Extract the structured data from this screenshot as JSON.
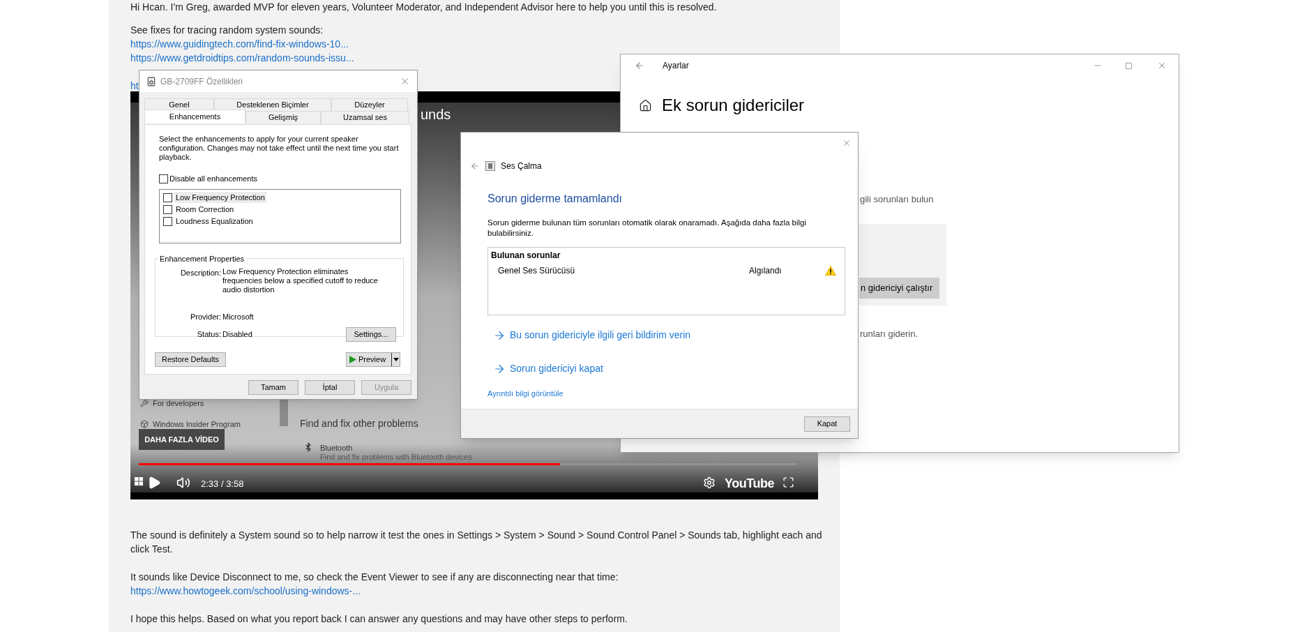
{
  "post": {
    "top_blocks": [
      [
        {
          "kind": "text",
          "text": "Hi Hcan. I'm Greg, awarded MVP for eleven years, Volunteer Moderator, and Independent Advisor here to help you until this is resolved."
        }
      ],
      [
        {
          "kind": "text",
          "text": "See fixes for tracing random system sounds:"
        },
        {
          "kind": "link",
          "text": "https://www.guidingtech.com/find-fix-windows-10..."
        },
        {
          "kind": "link",
          "text": "https://www.getdroidtips.com/random-sounds-issu..."
        }
      ],
      [
        {
          "kind": "link",
          "text": "ht"
        }
      ]
    ],
    "bottom_blocks": [
      [
        {
          "kind": "text",
          "text": "The sound is definitely a System sound so to help narrow it test the ones in Settings > System > Sound > Sound Control Panel > Sounds tab, highlight each and click Test."
        }
      ],
      [
        {
          "kind": "text",
          "text": "It sounds like Device Disconnect to me, so check the Event Viewer to see if any are disconnecting near that time:"
        },
        {
          "kind": "link",
          "text": "https://www.howtogeek.com/school/using-windows-..."
        }
      ],
      [
        {
          "kind": "text",
          "text": "I hope this helps. Based on what you report back I can answer any questions and may have other steps to perform."
        }
      ]
    ]
  },
  "video": {
    "title_fragment": "unds",
    "nav_items": [
      {
        "label": "For developers"
      },
      {
        "label": "Windows Insider Program"
      }
    ],
    "section_heading": "Find and fix other problems",
    "troubleshooter": {
      "title": "Bluetooth",
      "description": "Find and fix problems with Bluetooth devices"
    },
    "more_videos_button": "DAHA FAZLA VİDEO",
    "progress": {
      "level": 0.64
    },
    "time": "2:33 / 3:58",
    "logo": "YouTube"
  },
  "properties_dialog": {
    "title": "GB-2709FF Özellikleri",
    "tab_rows": [
      [
        {
          "label": "Genel",
          "selected": false
        },
        {
          "label": "Desteklenen Biçimler",
          "selected": false
        },
        {
          "label": "Düzeyler",
          "selected": false
        }
      ],
      [
        {
          "label": "Enhancements",
          "selected": true
        },
        {
          "label": "Gelişmiş",
          "selected": false
        },
        {
          "label": "Uzamsal ses",
          "selected": false
        }
      ]
    ],
    "intro": "Select the enhancements to apply for your current speaker configuration. Changes may not take effect until the next time you start playback.",
    "disable_all": {
      "label": "Disable all enhancements",
      "checked": false
    },
    "enhancements": [
      {
        "label": "Low Frequency Protection",
        "checked": false,
        "selected": true
      },
      {
        "label": "Room Correction",
        "checked": false,
        "selected": false
      },
      {
        "label": "Loudness Equalization",
        "checked": false,
        "selected": false
      }
    ],
    "properties": {
      "legend": "Enhancement Properties",
      "description_label": "Description:",
      "description": "Low Frequency Protection eliminates frequencies below a specified cutoff to reduce audio distortion",
      "provider_label": "Provider:",
      "provider": "Microsoft",
      "status_label": "Status:",
      "status": "Disabled",
      "settings_button": "Settings..."
    },
    "restore_button": "Restore Defaults",
    "preview_button": "Preview",
    "buttons": [
      {
        "label": "Tamam",
        "disabled": false
      },
      {
        "label": "İptal",
        "disabled": false
      },
      {
        "label": "Uygula",
        "disabled": true
      }
    ]
  },
  "settings_window": {
    "title": "Ayarlar",
    "heading": "Ek sorun gidericiler",
    "fragment_1": "gili sorunları bulun",
    "run_button": "n gidericiyi çalıştır",
    "fragment_2": "runları giderin."
  },
  "troubleshooter_dialog": {
    "title": "Ses Çalma",
    "heading": "Sorun giderme tamamlandı",
    "message": "Sorun giderme bulunan tüm sorunları otomatik olarak onaramadı. Aşağıda daha fazla bilgi bulabilirsiniz.",
    "problems": {
      "header": "Bulunan sorunlar",
      "rows": [
        {
          "name": "Genel Ses Sürücüsü",
          "status": "Algılandı",
          "kind": "warning"
        }
      ]
    },
    "actions": [
      "Bu sorun gidericiyle ilgili geri bildirim verin",
      "Sorun gidericiyi kapat"
    ],
    "details_link": "Ayrıntılı bilgi görüntüle",
    "close_button": "Kapat"
  }
}
